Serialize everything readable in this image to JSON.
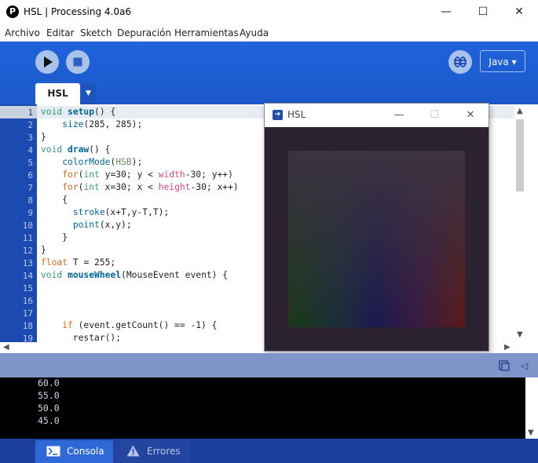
{
  "window": {
    "title": "HSL | Processing 4.0a6",
    "app_icon_glyph": "P",
    "minimize_glyph": "—",
    "maximize_glyph": "☐",
    "close_glyph": "✕"
  },
  "menu": [
    "Archivo",
    "Editar",
    "Sketch",
    "Depuración",
    "Herramientas",
    "Ayuda"
  ],
  "toolbar": {
    "run_icon": "play-icon",
    "stop_icon": "stop-icon",
    "debug_icon": "debug-icon",
    "mode_label": "Java ▾",
    "tab_label": "HSL",
    "tab_menu_glyph": "▼"
  },
  "editor": {
    "line_numbers": [
      "1",
      "2",
      "3",
      "4",
      "5",
      "6",
      "7",
      "8",
      "9",
      "10",
      "11",
      "12",
      "13",
      "14",
      "15",
      "16",
      "17",
      "18",
      "19"
    ],
    "current_line": 1
  },
  "sketch_window": {
    "title": "HSL",
    "icon_glyph": "➔",
    "minimize_glyph": "—",
    "maximize_glyph": "☐",
    "close_glyph": "✕"
  },
  "console": {
    "lines": [
      "60.0",
      "55.0",
      "50.0",
      "45.0"
    ]
  },
  "bottom_tabs": {
    "console_label": "Consola",
    "errors_label": "Errores"
  },
  "colors": {
    "toolbar_blue": "#1e5fd6",
    "gutter_blue": "#1b4bb0",
    "keyword_green": "#33997e",
    "function_blue": "#006699"
  }
}
